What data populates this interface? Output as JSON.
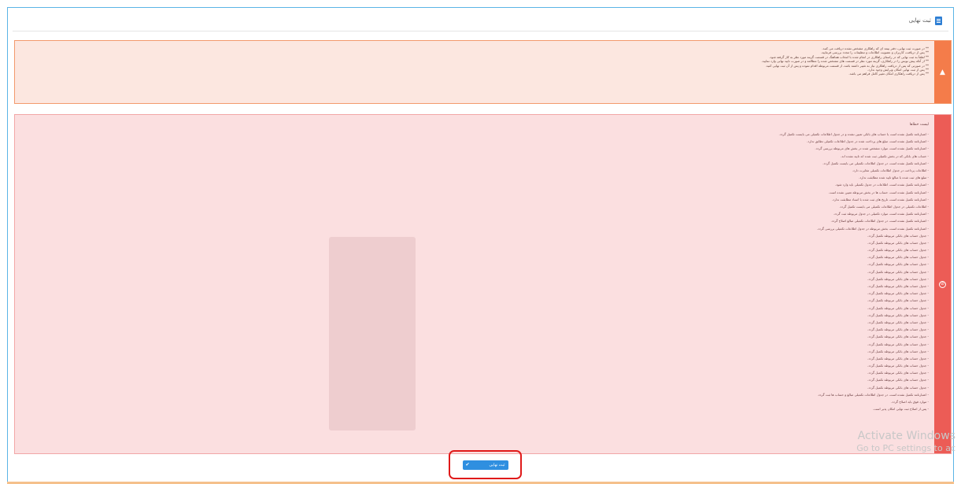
{
  "header": {
    "title": "ثبت نهایی",
    "icon": "document-icon"
  },
  "warning_panel": {
    "icon": "chevron-up-icon",
    "lines": [
      "** در صورت ثبت نهایی، دفتر بیمه ای که راهکاری مشخص نشده دریافت می کنند.",
      "** پس از دریافت، کاربران و عضویت اطلاعات و تنظیمات را مجدد بررسی فرمایید.",
      "** لطفاً به ثبت نهایی که در راستای راهکاری در انجام شده با انتخاب هماهنگ در قسمت گزینه مورد نظر به کار گرفته شود.",
      "** از آنکه پیش نویس را در راهکاری، گزینه مورد نظر در قسمت های مشخص شده را مطالعه و در صورت تایید نهایی وارد نمایید.",
      "** در صورتی که پس از دریافت راهکاری نیاز به تغییر داشته باشد، از قسمت مربوطه اقدام نموده و پس از آن ثبت نهایی کنید.",
      "** پس از ثبت نهایی امکان ویرایش وجود ندارد.",
      "** پس از دریافت راهکاری امکان تغییر کامل فراهم می باشد."
    ]
  },
  "error_panel": {
    "title": "لیست خطاها",
    "icon": "error-circle-icon",
    "lines": [
      "- اعتبارنامه تکمیل نشده است یا حساب های بانکی تعیین نشده و در جدول اطلاعات تکمیلی می بایست تکمیل گردد.",
      "- اعتبارنامه تکمیل نشده است، مبلغ های پرداخت شده در جدول اطلاعات تکمیلی تطابق ندارد.",
      "- اعتبارنامه تکمیل نشده است، موارد مشخص شده در بخش های مربوطه بررسی گردد.",
      "- حساب های بانکی که در بخش تکمیلی ثبت شده اند تایید نشده اند.",
      "- اعتبارنامه تکمیل نشده است، در جدول اطلاعات تکمیلی می بایست تکمیل گردد.",
      "- اطلاعات پرداخت در جدول اطلاعات تکمیلی مغایرت دارد.",
      "- مبلغ های ثبت شده با مبالغ تایید شده مطابقت ندارد.",
      "- اعتبارنامه تکمیل نشده است، اطلاعات در جدول تکمیلی باید وارد شود.",
      "- اعتبارنامه تکمیل نشده است، حساب ها در بخش مربوطه تعیین نشده است.",
      "- اعتبارنامه تکمیل نشده است، تاریخ های ثبت شده با اسناد مطابقت ندارد.",
      "- اطلاعات تکمیلی در جدول اطلاعات تکمیلی می بایست تکمیل گردد.",
      "- اعتبارنامه تکمیل نشده است، موارد تکمیلی در جدول مربوطه ثبت گردد.",
      "- اعتبارنامه تکمیل نشده است، در جدول اطلاعات تکمیلی مبالغ اصلاح گردد.",
      "- اعتبارنامه تکمیل نشده است، بخش مربوطه در جدول اطلاعات تکمیلی بررسی گردد.",
      "- جدول حساب های بانکی مربوطه تکمیل گردد.",
      "- جدول حساب های بانکی مربوطه تکمیل گردد.",
      "- جدول حساب های بانکی مربوطه تکمیل گردد.",
      "- جدول حساب های بانکی مربوطه تکمیل گردد.",
      "- جدول حساب های بانکی مربوطه تکمیل گردد.",
      "- جدول حساب های بانکی مربوطه تکمیل گردد.",
      "- جدول حساب های بانکی مربوطه تکمیل گردد.",
      "- جدول حساب های بانکی مربوطه تکمیل گردد.",
      "- جدول حساب های بانکی مربوطه تکمیل گردد.",
      "- جدول حساب های بانکی مربوطه تکمیل گردد.",
      "- جدول حساب های بانکی مربوطه تکمیل گردد.",
      "- جدول حساب های بانکی مربوطه تکمیل گردد.",
      "- جدول حساب های بانکی مربوطه تکمیل گردد.",
      "- جدول حساب های بانکی مربوطه تکمیل گردد.",
      "- جدول حساب های بانکی مربوطه تکمیل گردد.",
      "- جدول حساب های بانکی مربوطه تکمیل گردد.",
      "- جدول حساب های بانکی مربوطه تکمیل گردد.",
      "- جدول حساب های بانکی مربوطه تکمیل گردد.",
      "- جدول حساب های بانکی مربوطه تکمیل گردد.",
      "- جدول حساب های بانکی مربوطه تکمیل گردد.",
      "- جدول حساب های بانکی مربوطه تکمیل گردد.",
      "- جدول حساب های بانکی مربوطه تکمیل گردد.",
      "- اعتبارنامه تکمیل نشده است، در جدول اطلاعات تکمیلی مبالغ و حساب ها ثبت گردد.",
      "- موارد فوق باید اصلاح گردد.",
      "- پس از اصلاح ثبت نهایی امکان پذیر است."
    ]
  },
  "watermark": {
    "line1": "Activate Windows",
    "line2": "Go to PC settings to ac"
  },
  "submit_button": {
    "label": "ثبت نهایی",
    "icon": "check-icon"
  },
  "colors": {
    "warning_side": "#f47c4a",
    "error_side": "#ec5c56",
    "button": "#2f8fe0",
    "highlight": "#e01a1a"
  }
}
